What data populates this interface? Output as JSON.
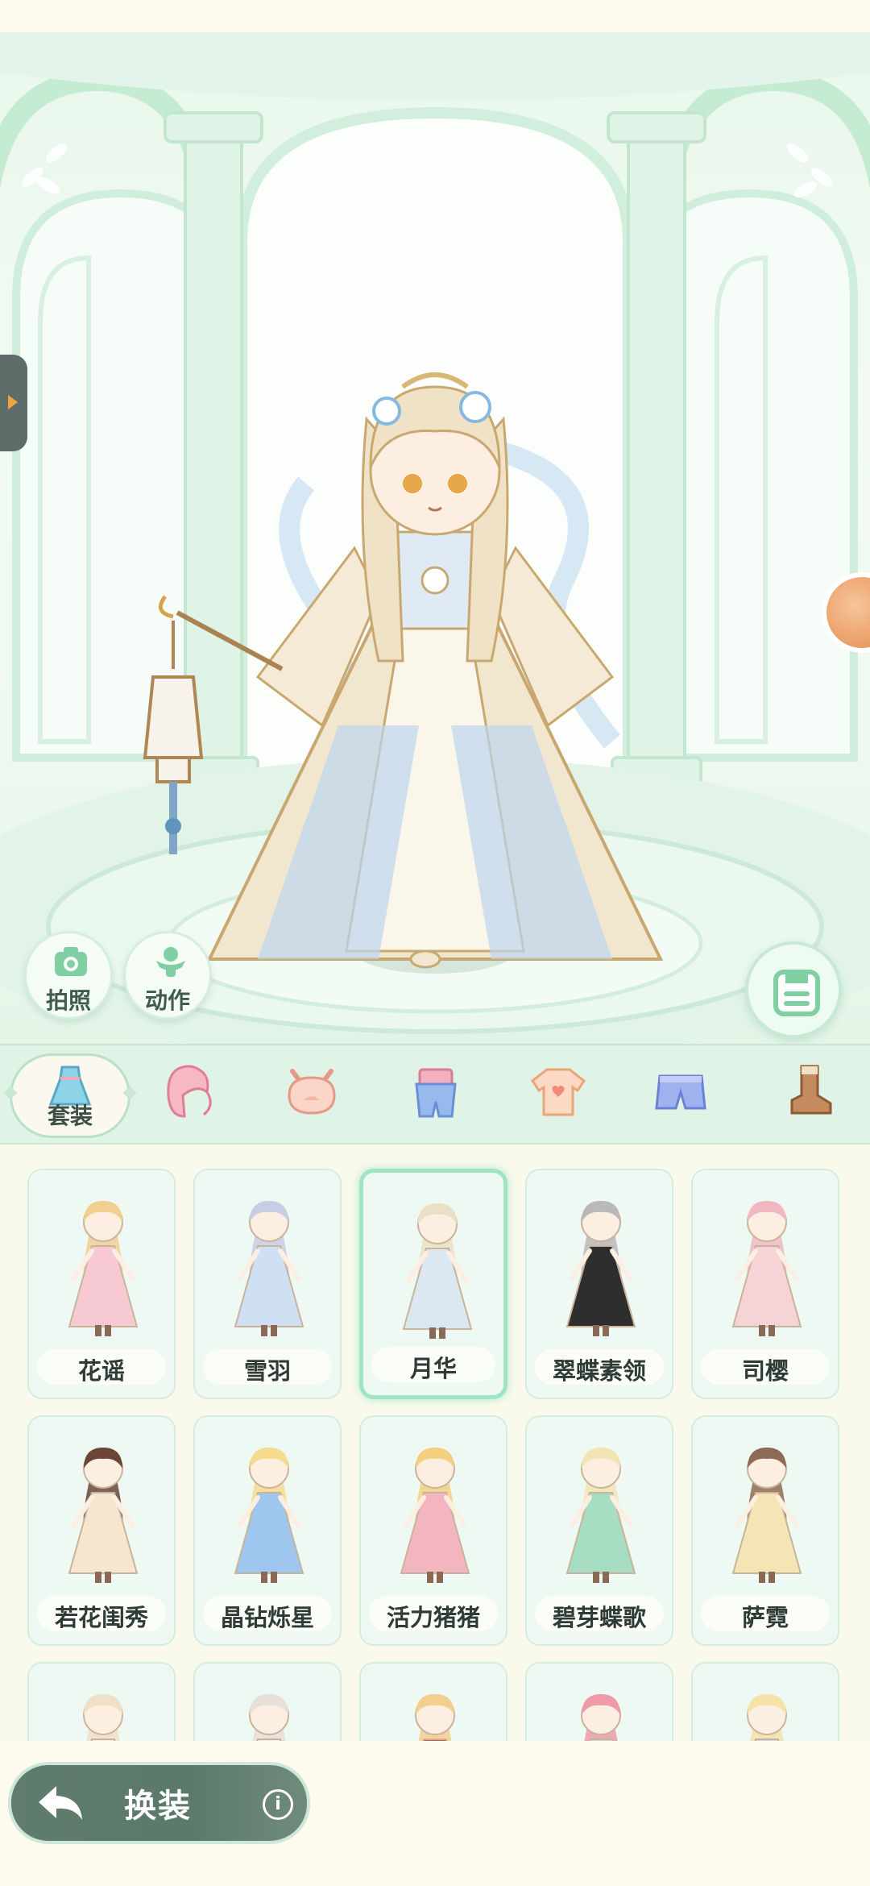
{
  "scene": {
    "photo_button": {
      "label": "拍照",
      "icon": "camera-icon"
    },
    "action_button": {
      "label": "动作",
      "icon": "pose-icon"
    },
    "save_button": {
      "icon": "save-icon"
    }
  },
  "categories": {
    "active_label": "套装",
    "items": [
      {
        "name": "suit",
        "icon": "dress-icon"
      },
      {
        "name": "hair",
        "icon": "hair-icon"
      },
      {
        "name": "head",
        "icon": "ears-icon"
      },
      {
        "name": "overalls",
        "icon": "overalls-icon"
      },
      {
        "name": "top",
        "icon": "tshirt-icon"
      },
      {
        "name": "bottom",
        "icon": "shorts-icon"
      },
      {
        "name": "shoes",
        "icon": "boot-icon"
      }
    ]
  },
  "outfits": [
    {
      "name": "花谣",
      "hair": "#f0cf90",
      "dress": "#f6c9d3",
      "selected": false
    },
    {
      "name": "雪羽",
      "hair": "#c9cde4",
      "dress": "#cfe0f4",
      "selected": false
    },
    {
      "name": "月华",
      "hair": "#ece0c4",
      "dress": "#dbe8f2",
      "selected": true
    },
    {
      "name": "翠蝶素领",
      "hair": "#b9b9b9",
      "dress": "#2e2e2e",
      "selected": false
    },
    {
      "name": "司樱",
      "hair": "#f2b8c2",
      "dress": "#f6d3d6",
      "selected": false
    },
    {
      "name": "若花闺秀",
      "hair": "#6b4638",
      "dress": "#f7e6cf",
      "selected": false
    },
    {
      "name": "晶钻烁星",
      "hair": "#f4db8e",
      "dress": "#9fc6ef",
      "selected": false
    },
    {
      "name": "活力猪猪",
      "hair": "#f3cf82",
      "dress": "#f3b6c0",
      "selected": false
    },
    {
      "name": "碧芽蝶歌",
      "hair": "#f1e5b6",
      "dress": "#a6ddc3",
      "selected": false
    },
    {
      "name": "萨霓",
      "hair": "#8d6a55",
      "dress": "#f4e6b4",
      "selected": false
    },
    {
      "name": "",
      "hair": "#f0e0c8",
      "dress": "#f2ede4",
      "selected": false
    },
    {
      "name": "",
      "hair": "#e6e0d8",
      "dress": "#eaf0f6",
      "selected": false
    },
    {
      "name": "",
      "hair": "#f2cf8c",
      "dress": "#d9544a",
      "selected": false
    },
    {
      "name": "",
      "hair": "#ef9aa8",
      "dress": "#b9e2cf",
      "selected": false
    },
    {
      "name": "",
      "hair": "#f6e2a8",
      "dress": "#c7d8f0",
      "selected": false
    }
  ],
  "bottom": {
    "change_label": "换装",
    "info_label": "i"
  }
}
